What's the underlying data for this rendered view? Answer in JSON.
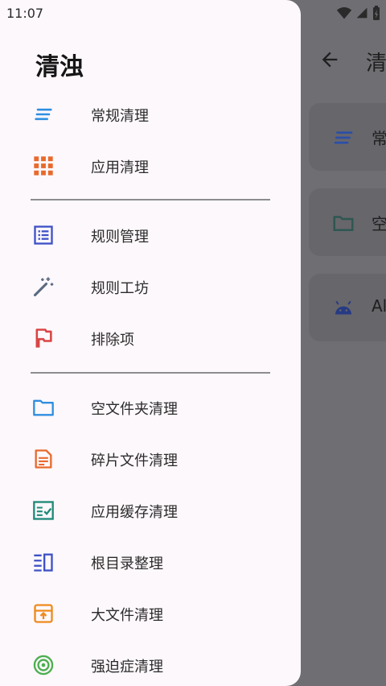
{
  "status_bar": {
    "time": "11:07"
  },
  "drawer": {
    "title": "清浊",
    "groups": [
      {
        "items": [
          {
            "label": "常规清理",
            "icon": "lines-icon"
          },
          {
            "label": "应用清理",
            "icon": "grid-icon"
          }
        ]
      },
      {
        "items": [
          {
            "label": "规则管理",
            "icon": "list-icon"
          },
          {
            "label": "规则工坊",
            "icon": "magic-wand-icon"
          },
          {
            "label": "排除项",
            "icon": "flag-icon"
          }
        ]
      },
      {
        "items": [
          {
            "label": "空文件夹清理",
            "icon": "folder-icon"
          },
          {
            "label": "碎片文件清理",
            "icon": "document-icon"
          },
          {
            "label": "应用缓存清理",
            "icon": "checklist-icon"
          },
          {
            "label": "根目录整理",
            "icon": "root-list-icon"
          },
          {
            "label": "大文件清理",
            "icon": "archive-icon"
          },
          {
            "label": "强迫症清理",
            "icon": "target-icon"
          }
        ]
      }
    ]
  },
  "background": {
    "title": "清",
    "cards": [
      {
        "label": "常"
      },
      {
        "label": "空"
      },
      {
        "label": "Al"
      }
    ]
  },
  "colors": {
    "drawer_bg": "#fdf8fc",
    "scrim": "#6f6e73",
    "blue": "#2f8ee0",
    "orange": "#e86a2c",
    "indigo": "#3f51c6",
    "red": "#d94545",
    "teal": "#1f8a78",
    "amber": "#ef8a1c",
    "green": "#4caf50"
  }
}
